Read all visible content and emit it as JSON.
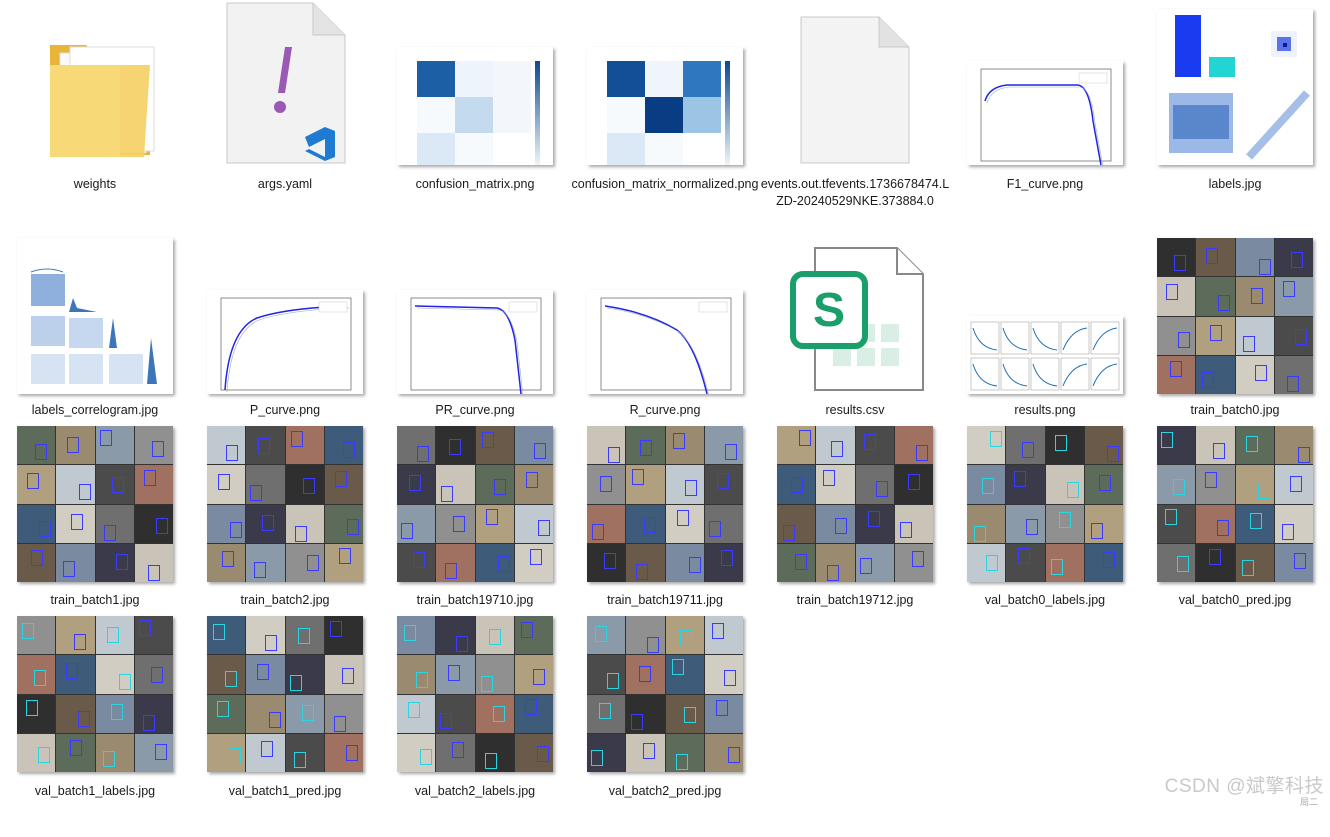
{
  "files": [
    {
      "name": "weights",
      "kind": "folder"
    },
    {
      "name": "args.yaml",
      "kind": "yaml",
      "icon": "vscode-icon"
    },
    {
      "name": "confusion_matrix.png",
      "kind": "chart-confusion"
    },
    {
      "name": "confusion_matrix_normalized.png",
      "kind": "chart-confusion-normalized"
    },
    {
      "name": "events.out.tfevents.1736678474.LZD-20240529NKE.373884.0",
      "kind": "document"
    },
    {
      "name": "F1_curve.png",
      "kind": "chart-curve"
    },
    {
      "name": "labels.jpg",
      "kind": "chart-labels"
    },
    {
      "name": "labels_correlogram.jpg",
      "kind": "chart-correlogram"
    },
    {
      "name": "P_curve.png",
      "kind": "chart-curve"
    },
    {
      "name": "PR_curve.png",
      "kind": "chart-curve"
    },
    {
      "name": "R_curve.png",
      "kind": "chart-curve"
    },
    {
      "name": "results.csv",
      "kind": "spreadsheet",
      "icon": "spreadsheet-s-icon",
      "accent": "#1a9e6a"
    },
    {
      "name": "results.png",
      "kind": "chart-results"
    },
    {
      "name": "train_batch0.jpg",
      "kind": "photo-mosaic"
    },
    {
      "name": "train_batch1.jpg",
      "kind": "photo-mosaic"
    },
    {
      "name": "train_batch2.jpg",
      "kind": "photo-mosaic"
    },
    {
      "name": "train_batch19710.jpg",
      "kind": "photo-mosaic"
    },
    {
      "name": "train_batch19711.jpg",
      "kind": "photo-mosaic"
    },
    {
      "name": "train_batch19712.jpg",
      "kind": "photo-mosaic"
    },
    {
      "name": "val_batch0_labels.jpg",
      "kind": "photo-mosaic"
    },
    {
      "name": "val_batch0_pred.jpg",
      "kind": "photo-mosaic"
    },
    {
      "name": "val_batch1_labels.jpg",
      "kind": "photo-mosaic"
    },
    {
      "name": "val_batch1_pred.jpg",
      "kind": "photo-mosaic"
    },
    {
      "name": "val_batch2_labels.jpg",
      "kind": "photo-mosaic"
    },
    {
      "name": "val_batch2_pred.jpg",
      "kind": "photo-mosaic"
    }
  ],
  "watermark": "CSDN @斌擎科技",
  "colors": {
    "folder": "#f3c64f",
    "matrix": "#0d4a8f",
    "curve": "#2323e6",
    "bbox": "#3b3bff"
  }
}
